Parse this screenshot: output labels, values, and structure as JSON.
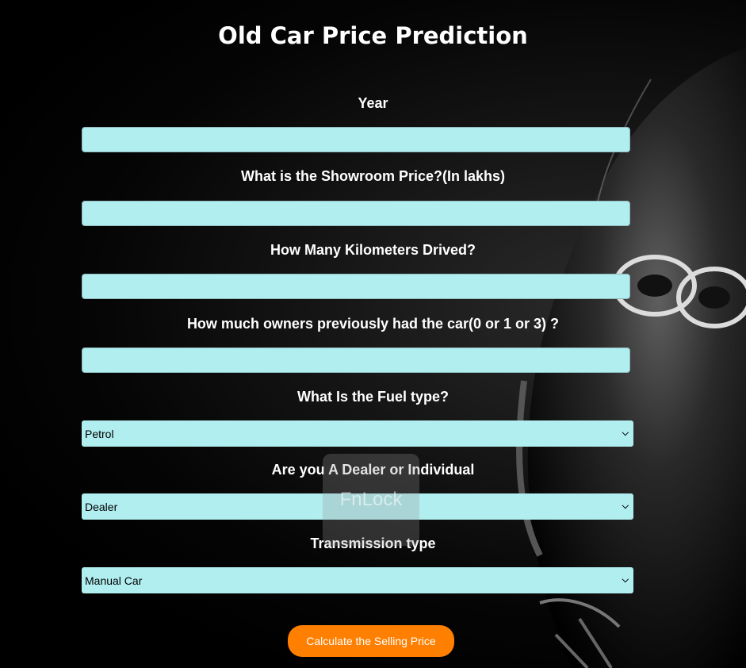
{
  "page": {
    "title": "Old Car Price Prediction"
  },
  "form": {
    "fields": [
      {
        "label": "Year",
        "value": "",
        "placeholder": ""
      },
      {
        "label": "What is the Showroom Price?(In lakhs)",
        "value": "",
        "placeholder": ""
      },
      {
        "label": "How Many Kilometers Drived?",
        "value": "",
        "placeholder": ""
      },
      {
        "label": "How much owners previously had the car(0 or 1 or 3) ?",
        "value": "",
        "placeholder": ""
      }
    ],
    "selects": [
      {
        "label": "What Is the Fuel type?",
        "selected": "Petrol"
      },
      {
        "label": "Are you A Dealer or Individual",
        "selected": "Dealer"
      },
      {
        "label": "Transmission type",
        "selected": "Manual Car"
      }
    ],
    "submit_label": "Calculate the Selling Price"
  },
  "overlay": {
    "fnlock_text": "FnLock"
  },
  "colors": {
    "background": "#000000",
    "field_bg": "#b1eeef",
    "button_bg": "#ff7f00",
    "text": "#ffffff"
  },
  "icons": {
    "select_arrow": "chevron-down-icon"
  }
}
